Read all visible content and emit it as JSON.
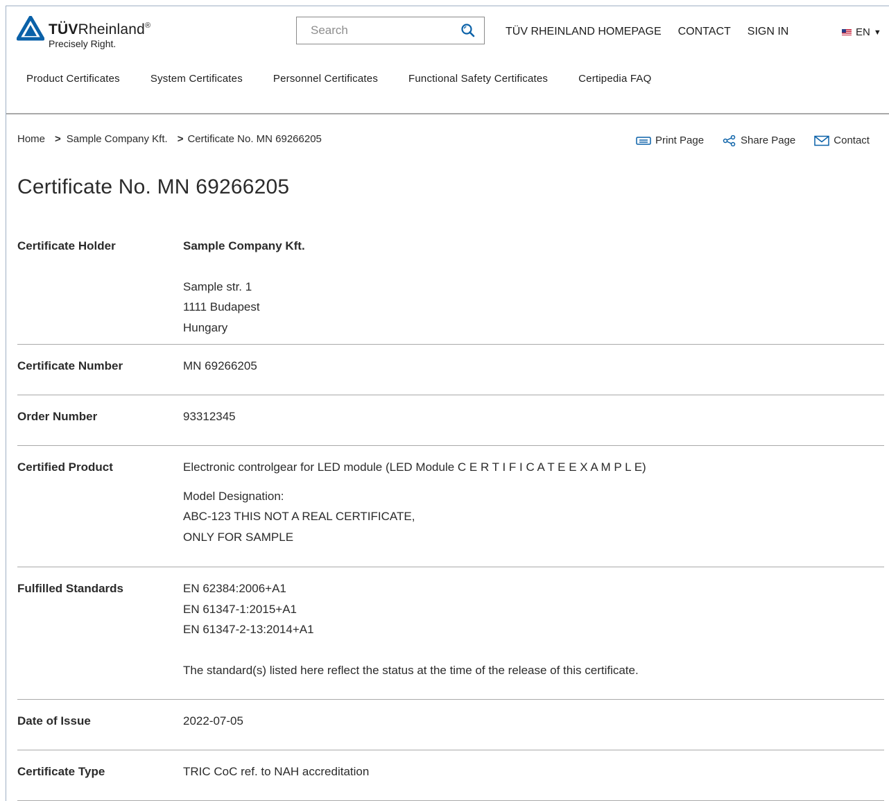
{
  "header": {
    "brand_bold": "TÜV",
    "brand_regular": "Rheinland",
    "brand_mark": "®",
    "tagline": "Precisely Right.",
    "search_placeholder": "Search",
    "links": [
      "TÜV RHEINLAND HOMEPAGE",
      "CONTACT",
      "SIGN IN"
    ],
    "language": "EN",
    "accent_color": "#0a61a8"
  },
  "nav": {
    "items": [
      "Product Certificates",
      "System Certificates",
      "Personnel Certificates",
      "Functional Safety Certificates",
      "Certipedia FAQ"
    ]
  },
  "breadcrumb": [
    "Home",
    "Sample Company Kft.",
    "Certificate No. MN 69266205"
  ],
  "actions": {
    "print": "Print Page",
    "share": "Share Page",
    "contact": "Contact"
  },
  "page_title": "Certificate No. MN 69266205",
  "details": {
    "holder_label": "Certificate Holder",
    "holder_name": "Sample Company Kft.",
    "holder_address": [
      "Sample str. 1",
      "1111 Budapest",
      "Hungary"
    ],
    "number_label": "Certificate Number",
    "number_value": "MN 69266205",
    "order_label": "Order Number",
    "order_value": "93312345",
    "product_label": "Certified Product",
    "product_value": "Electronic controlgear for LED module (LED Module C E R T I F I C A T E E X A M P L E)",
    "model_heading": "Model Designation:",
    "model_lines": [
      "ABC-123 THIS NOT A REAL CERTIFICATE,",
      "ONLY FOR SAMPLE"
    ],
    "standards_label": "Fulfilled Standards",
    "standards": [
      "EN 62384:2006+A1",
      "EN 61347-1:2015+A1",
      "EN 61347-2-13:2014+A1"
    ],
    "standards_note": "The standard(s) listed here reflect the status at the time of the release of this certificate.",
    "date_label": "Date of Issue",
    "date_value": "2022-07-05",
    "type_label": "Certificate Type",
    "type_value": "TRIC CoC ref. to NAH accreditation"
  }
}
